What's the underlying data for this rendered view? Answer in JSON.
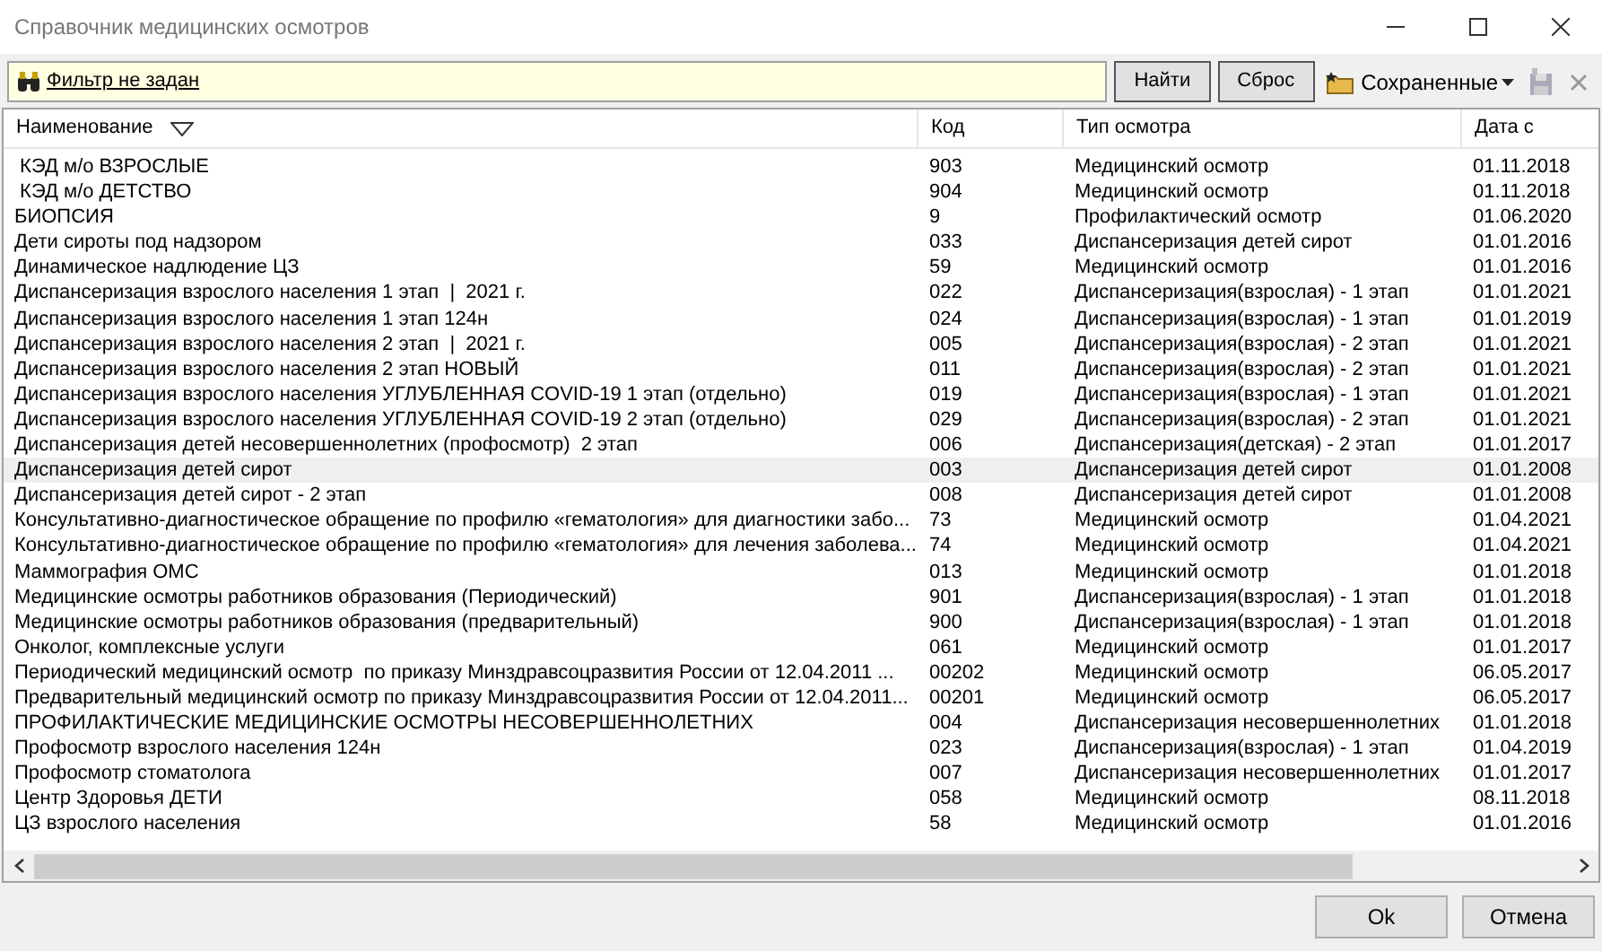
{
  "window": {
    "title": "Справочник медицинских осмотров"
  },
  "filter": {
    "text": "Фильтр не задан"
  },
  "toolbar": {
    "find_button": "Найти",
    "reset_button": "Сброс",
    "saved_menu": "Сохраненные"
  },
  "table": {
    "columns": [
      {
        "label": "Наименование",
        "sorted": true
      },
      {
        "label": "Код",
        "sorted": false
      },
      {
        "label": "Тип осмотра",
        "sorted": false
      },
      {
        "label": "Дата с",
        "sorted": false
      }
    ],
    "rows": [
      {
        "cells": [
          " КЭД м/о ВЗРОСЛЫЕ",
          "903",
          "Медицинский осмотр",
          "01.11.2018"
        ],
        "selected": false
      },
      {
        "cells": [
          " КЭД м/о ДЕТСТВО",
          "904",
          "Медицинский осмотр",
          "01.11.2018"
        ],
        "selected": false
      },
      {
        "cells": [
          "БИОПСИЯ",
          "9",
          "Профилактический осмотр",
          "01.06.2020"
        ],
        "selected": false
      },
      {
        "cells": [
          "Дети сироты под надзором",
          "033",
          "Диспансеризация детей сирот",
          "01.01.2016"
        ],
        "selected": false
      },
      {
        "cells": [
          "Динамическое надлюдение ЦЗ",
          "59",
          "Медицинский осмотр",
          "01.01.2016"
        ],
        "selected": false
      },
      {
        "cells": [
          "Диспансеризация взрослого населения 1 этап  |  2021 г.",
          "022",
          "Диспансеризация(взрослая) - 1 этап",
          "01.01.2021"
        ],
        "selected": false
      },
      {
        "cells": [
          "Диспансеризация взрослого населения 1 этап 124н",
          "024",
          "Диспансеризация(взрослая) - 1 этап",
          "01.01.2019"
        ],
        "selected": false
      },
      {
        "cells": [
          "Диспансеризация взрослого населения 2 этап  |  2021 г.",
          "005",
          "Диспансеризация(взрослая) - 2 этап",
          "01.01.2021"
        ],
        "selected": false
      },
      {
        "cells": [
          "Диспансеризация взрослого населения 2 этап НОВЫЙ",
          "011",
          "Диспансеризация(взрослая) - 2 этап",
          "01.01.2021"
        ],
        "selected": false
      },
      {
        "cells": [
          "Диспансеризация взрослого населения УГЛУБЛЕННАЯ COVID-19 1 этап (отдельно)",
          "019",
          "Диспансеризация(взрослая) - 1 этап",
          "01.01.2021"
        ],
        "selected": false
      },
      {
        "cells": [
          "Диспансеризация взрослого населения УГЛУБЛЕННАЯ COVID-19 2 этап (отдельно)",
          "029",
          "Диспансеризация(взрослая) - 2 этап",
          "01.01.2021"
        ],
        "selected": false
      },
      {
        "cells": [
          "Диспансеризация детей несовершеннолетних (профосмотр)  2 этап",
          "006",
          "Диспансеризация(детская) - 2 этап",
          "01.01.2017"
        ],
        "selected": false
      },
      {
        "cells": [
          "Диспансеризация детей сирот",
          "003",
          "Диспансеризация детей сирот",
          "01.01.2008"
        ],
        "selected": true
      },
      {
        "cells": [
          "Диспансеризация детей сирот - 2 этап",
          "008",
          "Диспансеризация детей сирот",
          "01.01.2008"
        ],
        "selected": false
      },
      {
        "cells": [
          "Консультативно-диагностическое обращение по профилю «гематология» для диагностики забо...",
          "73",
          "Медицинский осмотр",
          "01.04.2021"
        ],
        "selected": false
      },
      {
        "cells": [
          "Консультативно-диагностическое обращение по профилю «гематология» для лечения заболева...",
          "74",
          "Медицинский осмотр",
          "01.04.2021"
        ],
        "selected": false
      },
      {
        "cells": [
          "Маммография ОМС",
          "013",
          "Медицинский осмотр",
          "01.01.2018"
        ],
        "selected": false
      },
      {
        "cells": [
          "Медицинские осмотры работников образования (Периодический)",
          "901",
          "Диспансеризация(взрослая) - 1 этап",
          "01.01.2018"
        ],
        "selected": false
      },
      {
        "cells": [
          "Медицинские осмотры работников образования (предварительный)",
          "900",
          "Диспансеризация(взрослая) - 1 этап",
          "01.01.2018"
        ],
        "selected": false
      },
      {
        "cells": [
          "Онколог, комплексные услуги",
          "061",
          "Медицинский осмотр",
          "01.01.2017"
        ],
        "selected": false
      },
      {
        "cells": [
          "Периодический медицинский осмотр  по приказу Минздравсоцразвития России от 12.04.2011 ...",
          "00202",
          "Медицинский осмотр",
          "06.05.2017"
        ],
        "selected": false
      },
      {
        "cells": [
          "Предварительный медицинский осмотр по приказу Минздравсоцразвития России от 12.04.2011...",
          "00201",
          "Медицинский осмотр",
          "06.05.2017"
        ],
        "selected": false
      },
      {
        "cells": [
          "ПРОФИЛАКТИЧЕСКИЕ МЕДИЦИНСКИЕ ОСМОТРЫ НЕСОВЕРШЕННОЛЕТНИХ",
          "004",
          "Диспансеризация несовершеннолетних",
          "01.01.2018"
        ],
        "selected": false
      },
      {
        "cells": [
          "Профосмотр взрослого населения 124н",
          "023",
          "Диспансеризация(взрослая) - 1 этап",
          "01.04.2019"
        ],
        "selected": false
      },
      {
        "cells": [
          "Профосмотр стоматолога",
          "007",
          "Диспансеризация несовершеннолетних",
          "01.01.2017"
        ],
        "selected": false
      },
      {
        "cells": [
          "Центр Здоровья ДЕТИ",
          "058",
          "Медицинский осмотр",
          "08.11.2018"
        ],
        "selected": false
      },
      {
        "cells": [
          "ЦЗ взрослого населения",
          "58",
          "Медицинский осмотр",
          "01.01.2016"
        ],
        "selected": false
      }
    ]
  },
  "footer": {
    "ok_button": "Ok",
    "cancel_button": "Отмена"
  }
}
